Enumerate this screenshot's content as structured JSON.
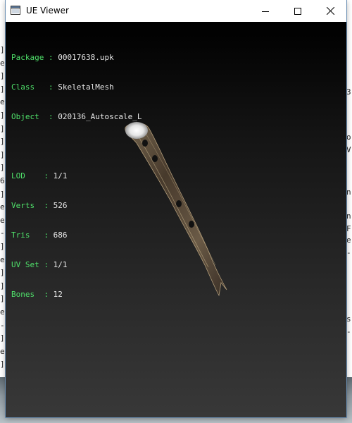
{
  "window": {
    "title": "UE Viewer",
    "controls": {
      "minimize": "minimize",
      "maximize": "maximize",
      "close": "close"
    }
  },
  "info": {
    "header": [
      {
        "key": "Package",
        "sep": " : ",
        "value": "00017638.upk"
      },
      {
        "key": "Class  ",
        "sep": " : ",
        "value": "SkeletalMesh"
      },
      {
        "key": "Object ",
        "sep": " : ",
        "value": "020136_Autoscale_L"
      }
    ],
    "stats": [
      {
        "key": "LOD    ",
        "sep": ": ",
        "value": "1/1"
      },
      {
        "key": "Verts  ",
        "sep": ": ",
        "value": "526"
      },
      {
        "key": "Tris   ",
        "sep": ": ",
        "value": "686"
      },
      {
        "key": "UV Set ",
        "sep": ": ",
        "value": "1/1"
      },
      {
        "key": "Bones  ",
        "sep": ": ",
        "value": "12"
      }
    ]
  },
  "background_left_glyphs": [
    "]",
    "e",
    "]",
    "]",
    "e",
    "]",
    "]",
    "]",
    "]",
    "]",
    "6",
    "]",
    "e",
    "e",
    "-",
    "]",
    "e",
    "]",
    "]",
    "]",
    "e",
    "-",
    "]",
    "e",
    "]"
  ],
  "background_right_glyphs": [
    "3",
    "o",
    "V",
    "n",
    "n",
    "F",
    "e",
    "-",
    "s",
    "-"
  ],
  "colors": {
    "label_green": "#4fe06a",
    "value_white": "#e8e8e8",
    "viewport_top": "#000000",
    "viewport_bottom": "#383838"
  },
  "icons": {
    "app": "window-app-icon",
    "minimize": "minimize-icon",
    "maximize": "maximize-icon",
    "close": "close-icon"
  }
}
